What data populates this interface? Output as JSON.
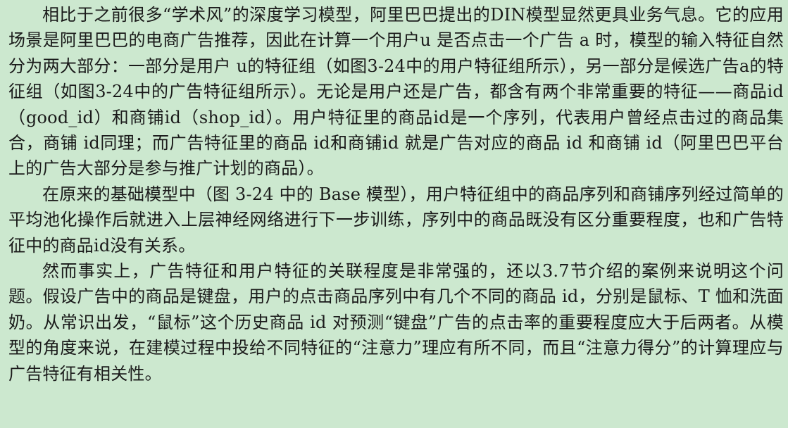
{
  "document": {
    "paragraphs": [
      "相比于之前很多“学术风”的深度学习模型，阿里巴巴提出的DIN模型显然更具业务气息。它的应用场景是阿里巴巴的电商广告推荐，因此在计算一个用户u 是否点击一个广告 a 时，模型的输入特征自然分为两大部分：一部分是用户 u的特征组（如图3-24中的用户特征组所示），另一部分是候选广告a的特征组（如图3-24中的广告特征组所示）。无论是用户还是广告，都含有两个非常重要的特征——商品id（good_id）和商铺id（shop_id）。用户特征里的商品id是一个序列，代表用户曾经点击过的商品集合，商铺 id同理；而广告特征里的商品 id和商铺id 就是广告对应的商品 id 和商铺 id（阿里巴巴平台上的广告大部分是参与推广计划的商品）。",
      "在原来的基础模型中（图 3-24 中的 Base 模型），用户特征组中的商品序列和商铺序列经过简单的平均池化操作后就进入上层神经网络进行下一步训练，序列中的商品既没有区分重要程度，也和广告特征中的商品id没有关系。",
      "然而事实上，广告特征和用户特征的关联程度是非常强的，还以3.7节介绍的案例来说明这个问题。假设广告中的商品是键盘，用户的点击商品序列中有几个不同的商品 id，分别是鼠标、T 恤和洗面奶。从常识出发，“鼠标”这个历史商品 id 对预测“键盘”广告的点击率的重要程度应大于后两者。从模型的角度来说，在建模过程中投给不同特征的“注意力”理应有所不同，而且“注意力得分”的计算理应与广告特征有相关性。"
    ]
  }
}
